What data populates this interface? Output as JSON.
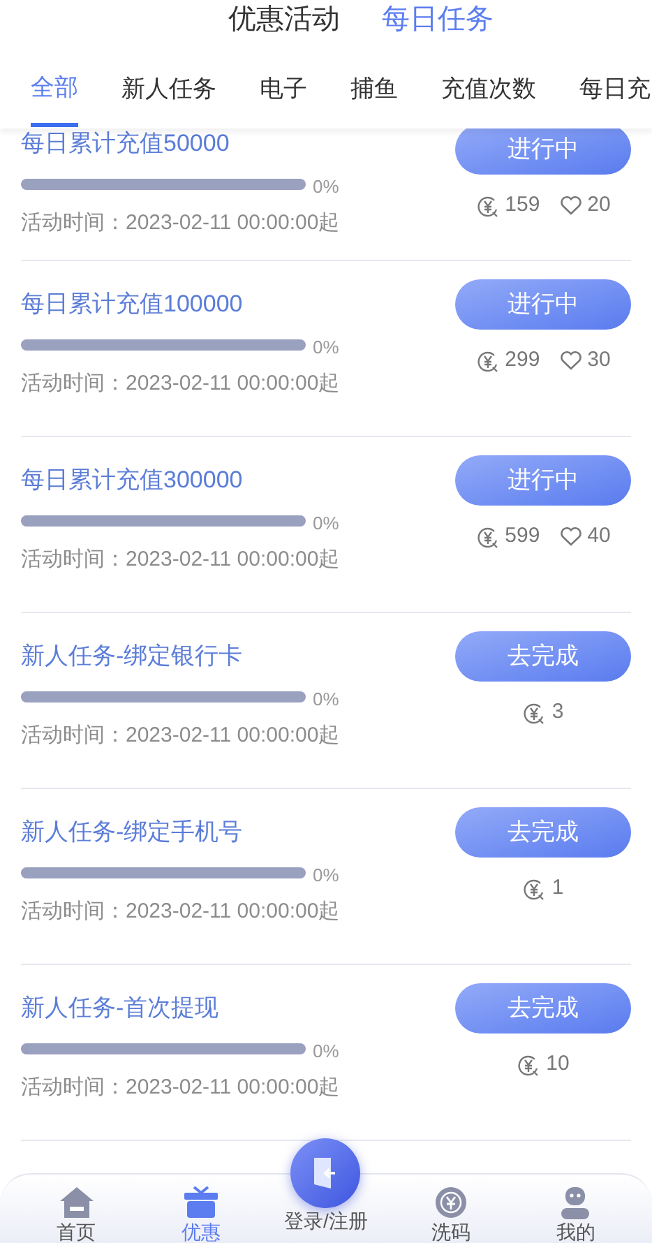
{
  "header_tabs": [
    {
      "label": "优惠活动",
      "selected": false
    },
    {
      "label": "每日任务",
      "selected": true
    }
  ],
  "category_tabs": [
    {
      "label": "全部",
      "selected": true
    },
    {
      "label": "新人任务",
      "selected": false
    },
    {
      "label": "电子",
      "selected": false
    },
    {
      "label": "捕鱼",
      "selected": false
    },
    {
      "label": "充值次数",
      "selected": false
    },
    {
      "label": "每日充",
      "selected": false
    }
  ],
  "tasks": [
    {
      "title": "每日累计充值50000",
      "level": 0,
      "percent": "0%",
      "time": "活动时间：2023-02-11 00:00:00起",
      "button": "进行中",
      "coins": "159",
      "likes": "20"
    },
    {
      "title": "每日累计充值100000",
      "level": 0,
      "percent": "0%",
      "time": "活动时间：2023-02-11 00:00:00起",
      "button": "进行中",
      "coins": "299",
      "likes": "30"
    },
    {
      "title": "每日累计充值300000",
      "level": 0,
      "percent": "0%",
      "time": "活动时间：2023-02-11 00:00:00起",
      "button": "进行中",
      "coins": "599",
      "likes": "40"
    },
    {
      "title": "新人任务-绑定银行卡",
      "level": 0,
      "percent": "0%",
      "time": "活动时间：2023-02-11 00:00:00起",
      "button": "去完成",
      "coins": "3"
    },
    {
      "title": "新人任务-绑定手机号",
      "level": 0,
      "percent": "0%",
      "time": "活动时间：2023-02-11 00:00:00起",
      "button": "去完成",
      "coins": "1"
    },
    {
      "title": "新人任务-首次提现",
      "level": 0,
      "percent": "0%",
      "time": "活动时间：2023-02-11 00:00:00起",
      "button": "去完成",
      "coins": "10"
    }
  ],
  "bottom_nav": [
    {
      "kind": "home",
      "label": "首页",
      "selected": false
    },
    {
      "kind": "gift",
      "label": "优惠",
      "selected": true
    },
    {
      "kind": "login",
      "label": "登录/注册",
      "selected": false
    },
    {
      "kind": "chip",
      "label": "洗码",
      "selected": false
    },
    {
      "kind": "user",
      "label": "我的",
      "selected": false
    }
  ]
}
